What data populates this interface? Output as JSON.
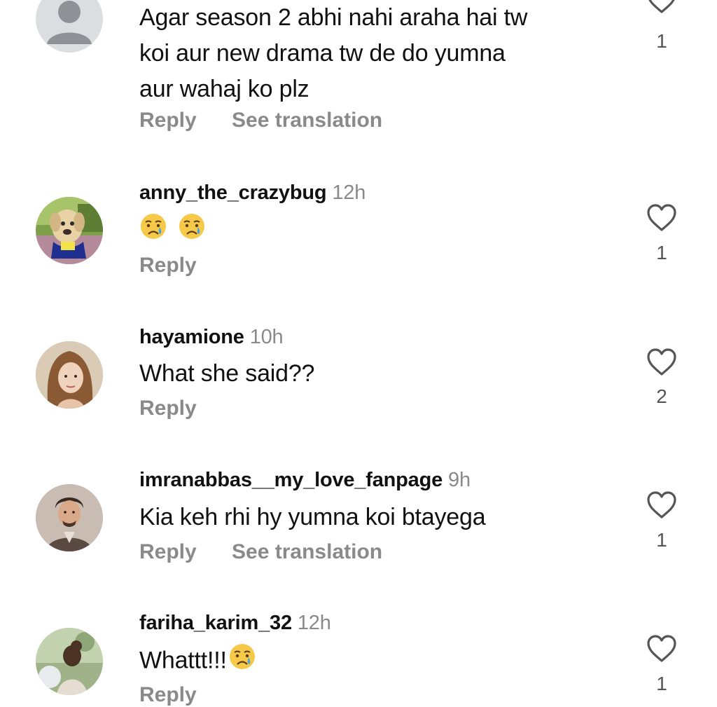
{
  "comments": [
    {
      "username": "",
      "time": "",
      "text_lines": [
        "Agar season 2 abhi nahi araha hai tw",
        "koi aur new drama tw de do yumna",
        "aur wahaj ko plz"
      ],
      "reply_label": "Reply",
      "translate_label": "See translation",
      "likes": "1",
      "avatar": "default-user-avatar"
    },
    {
      "username": "anny_the_crazybug",
      "time": "12h",
      "text_lines": [
        ""
      ],
      "emojis": [
        "crying-face-emoji",
        "crying-face-emoji"
      ],
      "reply_label": "Reply",
      "likes": "1",
      "avatar": "dog-photo-avatar"
    },
    {
      "username": "hayamione",
      "time": "10h",
      "text_lines": [
        "What she said??"
      ],
      "reply_label": "Reply",
      "likes": "2",
      "avatar": "girl-portrait-avatar"
    },
    {
      "username": "imranabbas__my_love_fanpage",
      "time": "9h",
      "text_lines": [
        "Kia keh rhi hy yumna koi btayega"
      ],
      "reply_label": "Reply",
      "translate_label": "See translation",
      "likes": "1",
      "avatar": "man-portrait-avatar"
    },
    {
      "username": "fariha_karim_32",
      "time": "12h",
      "text_lines": [
        "Whattt!!!"
      ],
      "emojis": [
        "crying-face-emoji"
      ],
      "reply_label": "Reply",
      "likes": "1",
      "avatar": "woman-back-avatar"
    }
  ],
  "colors": {
    "text": "#111111",
    "muted": "#8a8a8a",
    "count": "#555555",
    "heart_outline": "#555555",
    "emoji_face": "#f7c948",
    "emoji_tear": "#4aa3e0"
  }
}
